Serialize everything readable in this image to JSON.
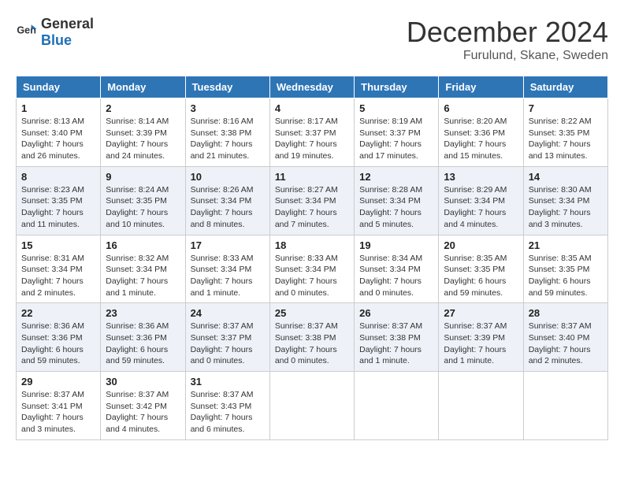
{
  "header": {
    "logo_general": "General",
    "logo_blue": "Blue",
    "month_title": "December 2024",
    "subtitle": "Furulund, Skane, Sweden"
  },
  "days_of_week": [
    "Sunday",
    "Monday",
    "Tuesday",
    "Wednesday",
    "Thursday",
    "Friday",
    "Saturday"
  ],
  "weeks": [
    [
      {
        "day": 1,
        "info": "Sunrise: 8:13 AM\nSunset: 3:40 PM\nDaylight: 7 hours\nand 26 minutes."
      },
      {
        "day": 2,
        "info": "Sunrise: 8:14 AM\nSunset: 3:39 PM\nDaylight: 7 hours\nand 24 minutes."
      },
      {
        "day": 3,
        "info": "Sunrise: 8:16 AM\nSunset: 3:38 PM\nDaylight: 7 hours\nand 21 minutes."
      },
      {
        "day": 4,
        "info": "Sunrise: 8:17 AM\nSunset: 3:37 PM\nDaylight: 7 hours\nand 19 minutes."
      },
      {
        "day": 5,
        "info": "Sunrise: 8:19 AM\nSunset: 3:37 PM\nDaylight: 7 hours\nand 17 minutes."
      },
      {
        "day": 6,
        "info": "Sunrise: 8:20 AM\nSunset: 3:36 PM\nDaylight: 7 hours\nand 15 minutes."
      },
      {
        "day": 7,
        "info": "Sunrise: 8:22 AM\nSunset: 3:35 PM\nDaylight: 7 hours\nand 13 minutes."
      }
    ],
    [
      {
        "day": 8,
        "info": "Sunrise: 8:23 AM\nSunset: 3:35 PM\nDaylight: 7 hours\nand 11 minutes."
      },
      {
        "day": 9,
        "info": "Sunrise: 8:24 AM\nSunset: 3:35 PM\nDaylight: 7 hours\nand 10 minutes."
      },
      {
        "day": 10,
        "info": "Sunrise: 8:26 AM\nSunset: 3:34 PM\nDaylight: 7 hours\nand 8 minutes."
      },
      {
        "day": 11,
        "info": "Sunrise: 8:27 AM\nSunset: 3:34 PM\nDaylight: 7 hours\nand 7 minutes."
      },
      {
        "day": 12,
        "info": "Sunrise: 8:28 AM\nSunset: 3:34 PM\nDaylight: 7 hours\nand 5 minutes."
      },
      {
        "day": 13,
        "info": "Sunrise: 8:29 AM\nSunset: 3:34 PM\nDaylight: 7 hours\nand 4 minutes."
      },
      {
        "day": 14,
        "info": "Sunrise: 8:30 AM\nSunset: 3:34 PM\nDaylight: 7 hours\nand 3 minutes."
      }
    ],
    [
      {
        "day": 15,
        "info": "Sunrise: 8:31 AM\nSunset: 3:34 PM\nDaylight: 7 hours\nand 2 minutes."
      },
      {
        "day": 16,
        "info": "Sunrise: 8:32 AM\nSunset: 3:34 PM\nDaylight: 7 hours\nand 1 minute."
      },
      {
        "day": 17,
        "info": "Sunrise: 8:33 AM\nSunset: 3:34 PM\nDaylight: 7 hours\nand 1 minute."
      },
      {
        "day": 18,
        "info": "Sunrise: 8:33 AM\nSunset: 3:34 PM\nDaylight: 7 hours\nand 0 minutes."
      },
      {
        "day": 19,
        "info": "Sunrise: 8:34 AM\nSunset: 3:34 PM\nDaylight: 7 hours\nand 0 minutes."
      },
      {
        "day": 20,
        "info": "Sunrise: 8:35 AM\nSunset: 3:35 PM\nDaylight: 6 hours\nand 59 minutes."
      },
      {
        "day": 21,
        "info": "Sunrise: 8:35 AM\nSunset: 3:35 PM\nDaylight: 6 hours\nand 59 minutes."
      }
    ],
    [
      {
        "day": 22,
        "info": "Sunrise: 8:36 AM\nSunset: 3:36 PM\nDaylight: 6 hours\nand 59 minutes."
      },
      {
        "day": 23,
        "info": "Sunrise: 8:36 AM\nSunset: 3:36 PM\nDaylight: 6 hours\nand 59 minutes."
      },
      {
        "day": 24,
        "info": "Sunrise: 8:37 AM\nSunset: 3:37 PM\nDaylight: 7 hours\nand 0 minutes."
      },
      {
        "day": 25,
        "info": "Sunrise: 8:37 AM\nSunset: 3:38 PM\nDaylight: 7 hours\nand 0 minutes."
      },
      {
        "day": 26,
        "info": "Sunrise: 8:37 AM\nSunset: 3:38 PM\nDaylight: 7 hours\nand 1 minute."
      },
      {
        "day": 27,
        "info": "Sunrise: 8:37 AM\nSunset: 3:39 PM\nDaylight: 7 hours\nand 1 minute."
      },
      {
        "day": 28,
        "info": "Sunrise: 8:37 AM\nSunset: 3:40 PM\nDaylight: 7 hours\nand 2 minutes."
      }
    ],
    [
      {
        "day": 29,
        "info": "Sunrise: 8:37 AM\nSunset: 3:41 PM\nDaylight: 7 hours\nand 3 minutes."
      },
      {
        "day": 30,
        "info": "Sunrise: 8:37 AM\nSunset: 3:42 PM\nDaylight: 7 hours\nand 4 minutes."
      },
      {
        "day": 31,
        "info": "Sunrise: 8:37 AM\nSunset: 3:43 PM\nDaylight: 7 hours\nand 6 minutes."
      },
      null,
      null,
      null,
      null
    ]
  ]
}
